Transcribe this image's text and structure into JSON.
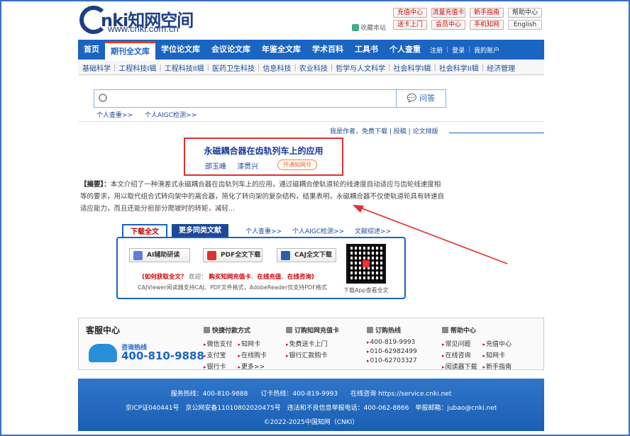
{
  "header": {
    "logo_text": "nki知网空间",
    "logo_url": "www.cnki.com.cn",
    "favorite": "收藏本站",
    "top_links": [
      "充值中心",
      "流量充值卡",
      "新手指南",
      "帮助中心",
      "送卡上门",
      "会员中心",
      "手机知网",
      "English"
    ]
  },
  "nav": {
    "items": [
      "首页",
      "期刊全文库",
      "学位论文库",
      "会议论文库",
      "年鉴全文库",
      "学术百科",
      "工具书",
      "个人查重"
    ],
    "active": "期刊全文库",
    "account": [
      "注册",
      "登录",
      "我的账户"
    ]
  },
  "subnav": [
    "基础科学",
    "工程科技I辑",
    "工程科技II辑",
    "医药卫生科技",
    "信息科技",
    "农业科技",
    "哲学与人文科学",
    "社会科学I辑",
    "社会科学II辑",
    "经济管理"
  ],
  "search": {
    "placeholder": "",
    "ask_label": "问答",
    "quick_links": [
      "个人查重>>",
      "个人AIGC检测>>"
    ]
  },
  "article": {
    "toolbar": [
      "我是作者，免费下载",
      "投稿",
      "论文排版"
    ],
    "title": "永磁耦合器在齿轨列车上的应用",
    "authors": [
      "邵玉峰",
      "漆贯兴"
    ],
    "open_button": "开通知网号",
    "abstract_label": "【摘要】：",
    "abstract_text": "本文介绍了一种滑差式永磁耦合器在齿轨列车上的应用，通过磁耦合使轨道轮的线速度自动适应与齿轮线速度相等的要求，用以取代组合式转向架中的离合器，简化了转向架的复杂结构，结果表明，永磁耦合器不仅使轨道轮具有转速自适应能力，而且还能分担部分爬坡时的转矩，减轻..."
  },
  "download": {
    "tab_active": "下载全文",
    "tab_other": "更多同类文献",
    "links": [
      "个人查重>>",
      "个人AIGC检测>>",
      "文献综述>>"
    ],
    "buttons": [
      "AI辅助研读",
      "PDF全文下载",
      "CAJ全文下载"
    ],
    "hint_prefix": "(如何获取全文？",
    "hint_welcome": "欢迎：",
    "hint_buy": "购买知网充值卡",
    "hint_online": "在线充值",
    "hint_consult": "在线咨询",
    "hint_suffix": ")",
    "reader_note": "CAJViewer阅读器支持CAJ、PDF文件格式，AdobeReader仅支持PDF格式",
    "qr_caption": "下载App查看全文"
  },
  "service": {
    "title": "客服中心",
    "hotline_label": "咨询热线",
    "hotline": "400-810-9888",
    "cols": [
      {
        "title": "快捷付款方式",
        "items": [
          "微信支付",
          "知网卡",
          "支付宝",
          "在线购卡",
          "银行卡",
          "更多>>"
        ]
      },
      {
        "title": "订购知网充值卡",
        "items": [
          "免费送卡上门",
          "银行汇款购卡"
        ]
      },
      {
        "title": "订购热线",
        "items": [
          "400-819-9993",
          "010-62982499",
          "010-62703327"
        ]
      },
      {
        "title": "帮助中心",
        "items": [
          "常见问题",
          "充值中心",
          "在线咨询",
          "知网卡",
          "阅读器下载",
          "新手指南"
        ]
      }
    ]
  },
  "footer": {
    "line1": "服务热线：400-810-9888　　订卡热线：400-819-9993　　在线咨询 https://service.cnki.net",
    "line2": "京ICP证040441号　京公网安备11010802020475号　违法和不良信息举报电话：400-062-8866　举报邮箱：jubao@cnki.net",
    "line3": "©2022-2025中国知网（CNKI）"
  },
  "colors": {
    "brand": "#1a64c2",
    "highlight": "#e03030"
  }
}
